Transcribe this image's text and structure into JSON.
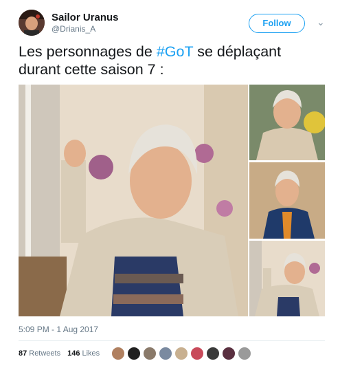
{
  "tweet": {
    "display_name": "Sailor Uranus",
    "handle": "@Drianis_A",
    "follow_label": "Follow",
    "text_before": "Les personnages de ",
    "hashtag": "#GoT",
    "text_after": " se déplaçant durant cette saison 7 :",
    "timestamp": "5:09 PM - 1 Aug 2017"
  },
  "stats": {
    "retweets_count": "87",
    "retweets_label": "Retweets",
    "likes_count": "146",
    "likes_label": "Likes"
  },
  "colors": {
    "accent": "#1da1f2",
    "meta": "#657786"
  },
  "icons": {
    "menu": "chevron-down-icon"
  },
  "likers_count": 9
}
